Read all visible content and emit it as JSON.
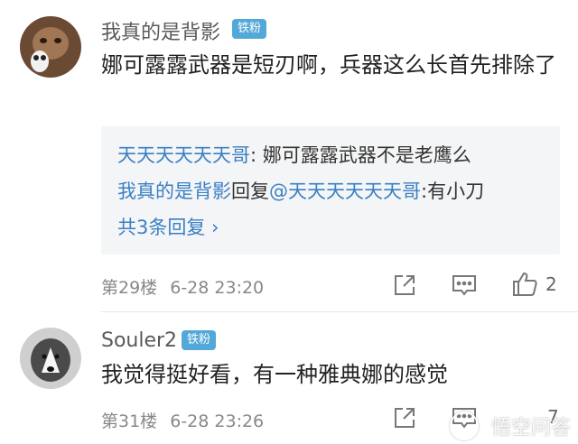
{
  "comments": [
    {
      "username": "我真的是背影",
      "badge": "铁粉",
      "content": "娜可露露武器是短刃啊，兵器这么长首先排除了",
      "replies": {
        "line1_user": "天天天天天天哥",
        "line1_sep": ": ",
        "line1_text": "娜可露露武器不是老鹰么",
        "line2_user": "我真的是背影",
        "line2_mid": "回复",
        "line2_target": "@天天天天天天哥",
        "line2_text": ":有小刀",
        "more": "共3条回复 ›"
      },
      "floor": "第29楼",
      "time": "6-28 23:20",
      "likes": "2"
    },
    {
      "username": "Souler2",
      "badge": "铁粉",
      "content": "我觉得挺好看，有一种雅典娜的感觉",
      "floor": "第31楼",
      "time": "6-28 23:26",
      "likes": "7"
    }
  ],
  "watermark": "悟空问答",
  "colors": {
    "link": "#3a80c4",
    "badge": "#52a8d9",
    "reply_bg": "#f4f5f6"
  }
}
